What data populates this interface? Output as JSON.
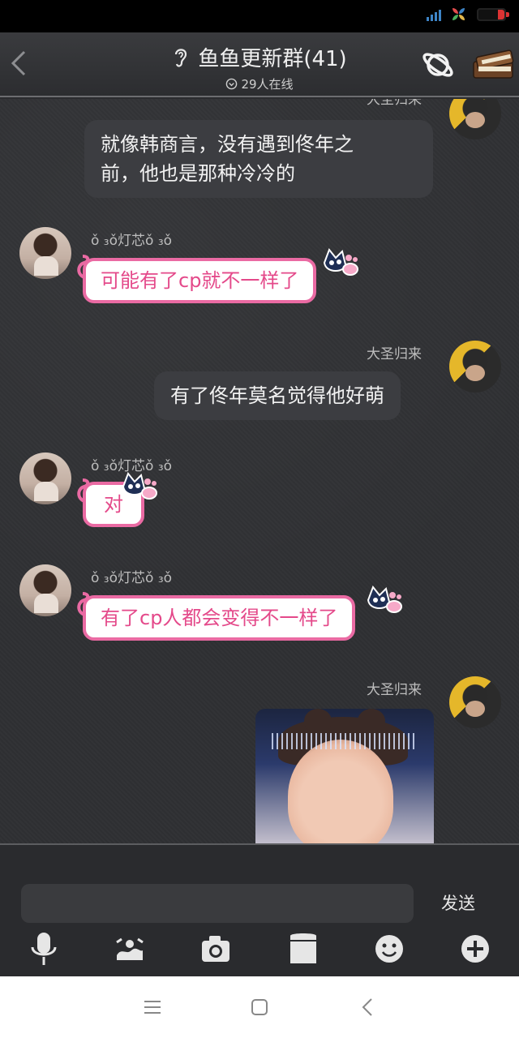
{
  "header": {
    "title": "鱼鱼更新群(41)",
    "online": "29人在线"
  },
  "messages": [
    {
      "sender": "大圣归来",
      "text_line1": "就像韩商言，没有遇到佟年之",
      "text_line2": "前，他也是那种冷冷的",
      "side": "right"
    },
    {
      "sender": "ǒ ₃ǒ灯芯ǒ ₃ǒ",
      "text": "可能有了cp就不一样了",
      "side": "left"
    },
    {
      "sender": "大圣归来",
      "text": "有了佟年莫名觉得他好萌",
      "side": "right"
    },
    {
      "sender": "ǒ ₃ǒ灯芯ǒ ₃ǒ",
      "text": "对",
      "side": "left"
    },
    {
      "sender": "ǒ ₃ǒ灯芯ǒ ₃ǒ",
      "text": "有了cp人都会变得不一样了",
      "side": "left"
    },
    {
      "sender": "大圣归来",
      "type": "image",
      "side": "right"
    }
  ],
  "composer": {
    "placeholder": "",
    "send_label": "发送"
  },
  "toolbar": {
    "icons": [
      "microphone-icon",
      "picture-icon",
      "camera-icon",
      "file-icon",
      "emoji-icon",
      "plus-icon"
    ]
  },
  "colors": {
    "pink_border": "#ea6aa3",
    "pink_text": "#e4498a",
    "dark_bubble": "#3c3d41"
  }
}
